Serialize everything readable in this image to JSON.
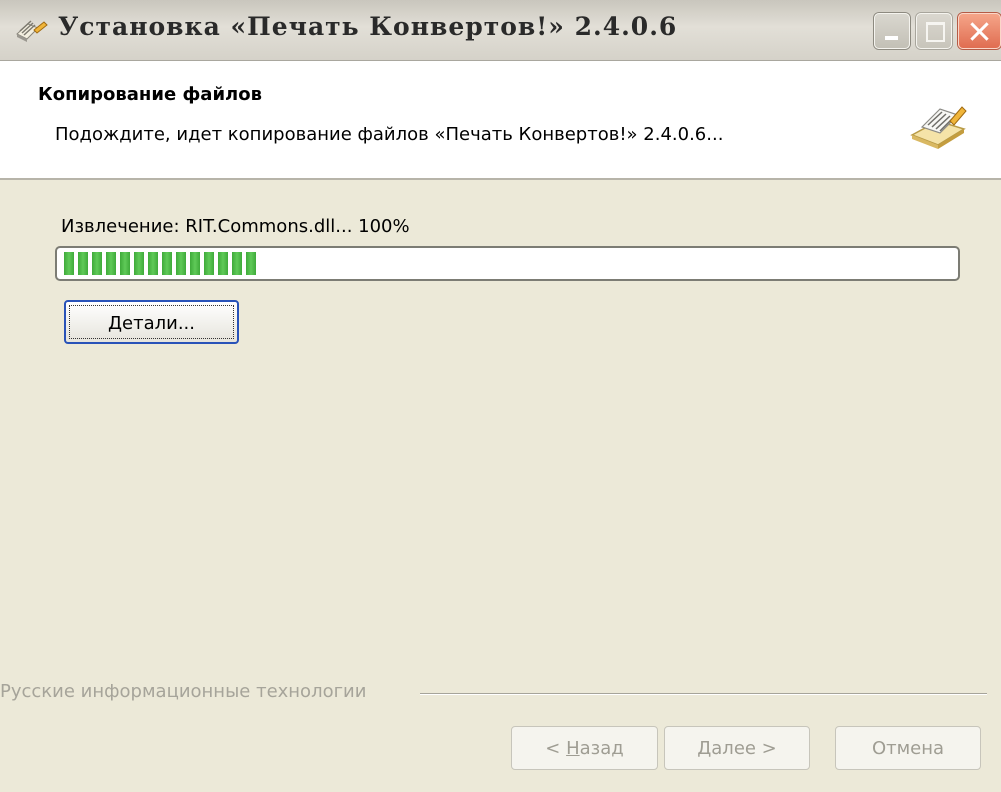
{
  "window": {
    "title": "Установка «Печать Конвертов!» 2.4.0.6",
    "icon": "installer-app-icon",
    "controls": {
      "minimize": "minimize-icon",
      "maximize": "maximize-icon",
      "close": "close-icon"
    }
  },
  "header": {
    "title": "Копирование файлов",
    "subtitle": "Подождите, идет копирование файлов «Печать Конвертов!» 2.4.0.6...",
    "icon": "envelope-print-icon"
  },
  "progress": {
    "status_text": "Извлечение: RIT.Commons.dll... 100%",
    "fill_fraction": 0.22,
    "colors": {
      "fill": "#3faa3a",
      "border": "#7c7c74"
    }
  },
  "details_button": {
    "label_accel": "Д",
    "label_rest": "етали..."
  },
  "footer": {
    "company": "Русские информационные технологии",
    "back": {
      "prefix": "< ",
      "accel": "Н",
      "rest": "азад"
    },
    "next": {
      "accel": "Д",
      "rest": "алее >"
    },
    "cancel": "Отмена"
  },
  "colors": {
    "dialog_bg": "#ece9d8",
    "header_bg": "#ffffff",
    "disabled_text": "#9f9d93",
    "focus_border": "#2852b8"
  }
}
